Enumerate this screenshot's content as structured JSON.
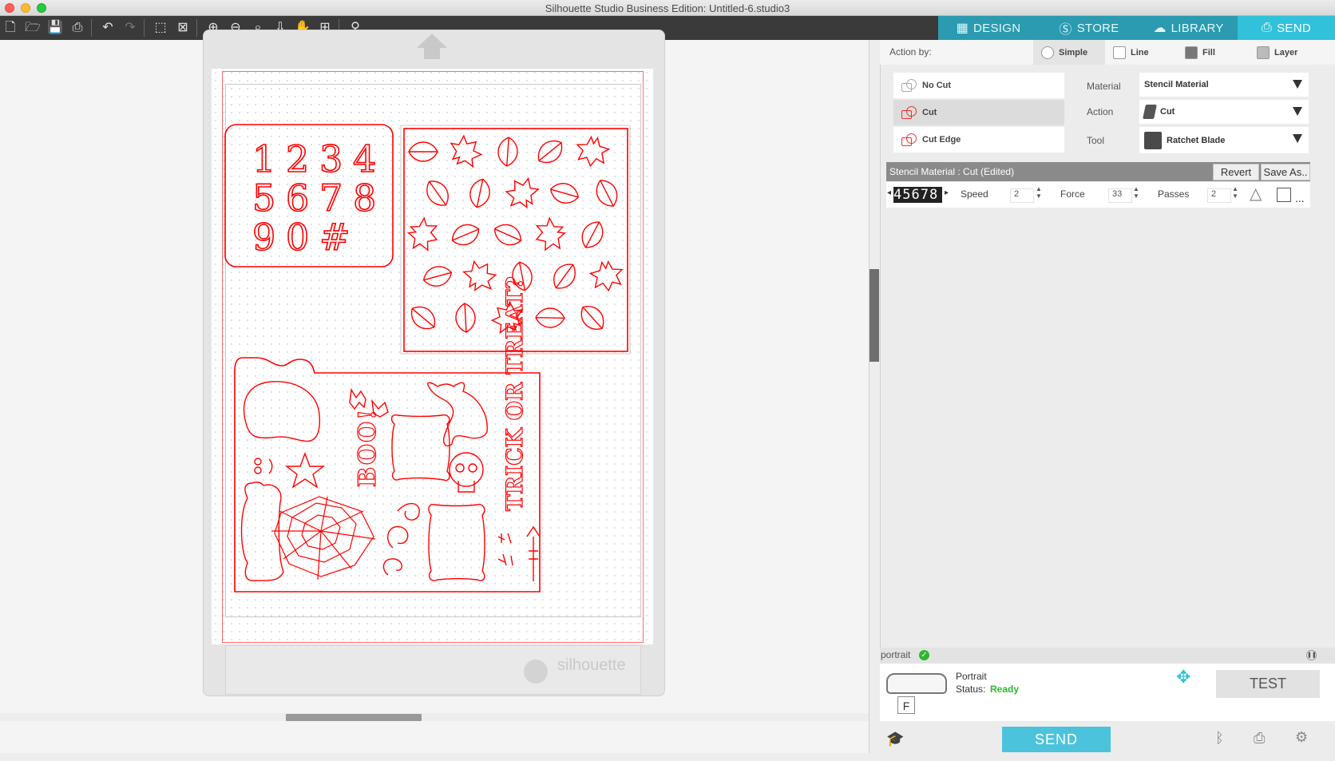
{
  "window": {
    "title": "Silhouette Studio Business Edition: Untitled-6.studio3"
  },
  "mode_tabs": [
    {
      "label": "DESIGN",
      "icon": "grid-icon"
    },
    {
      "label": "STORE",
      "icon": "silhouette-s-icon"
    },
    {
      "label": "LIBRARY",
      "icon": "cloud-icon"
    },
    {
      "label": "SEND",
      "icon": "cutter-icon"
    }
  ],
  "toolbar": {
    "icons": [
      "new-file-icon",
      "open-folder-icon",
      "save-icon",
      "print-icon",
      "undo-icon",
      "redo-icon",
      "select-all-icon",
      "deselect-icon",
      "zoom-in-icon",
      "zoom-out-icon",
      "zoom-selection-icon",
      "move-down-icon",
      "pan-hand-icon",
      "fit-to-page-icon",
      "trace-icon"
    ]
  },
  "canvas": {
    "numbers": [
      "1",
      "2",
      "3",
      "4",
      "5",
      "6",
      "7",
      "8",
      "9",
      "0",
      "#"
    ],
    "boo_text": "BOO!",
    "trick_text": "TRICK OR TREAT?",
    "mat_logo": "silhouette"
  },
  "send_panel": {
    "action_by_label": "Action by:",
    "action_by_tabs": [
      "Simple",
      "Line",
      "Fill",
      "Layer"
    ],
    "cut_options": [
      "No Cut",
      "Cut",
      "Cut Edge"
    ],
    "material_label": "Material",
    "material_value": "Stencil Material",
    "action_label": "Action",
    "action_value": "Cut",
    "tool_label": "Tool",
    "tool_value": "Ratchet Blade",
    "mat_header": "Stencil Material : Cut (Edited)",
    "revert_label": "Revert",
    "save_as_label": "Save As..",
    "blade_display": "45678",
    "speed_label": "Speed",
    "speed_value": "2",
    "force_label": "Force",
    "force_value": "33",
    "passes_label": "Passes",
    "passes_value": "2",
    "more_label": "..."
  },
  "device": {
    "header": "portrait",
    "name": "Portrait",
    "status_label": "Status:",
    "status_value": "Ready",
    "blade_letter": "F",
    "test_label": "TEST",
    "send_label": "SEND"
  },
  "colors": {
    "accent": "#32c1da",
    "cut_line": "#ff0000",
    "ready": "#2eb82e"
  }
}
